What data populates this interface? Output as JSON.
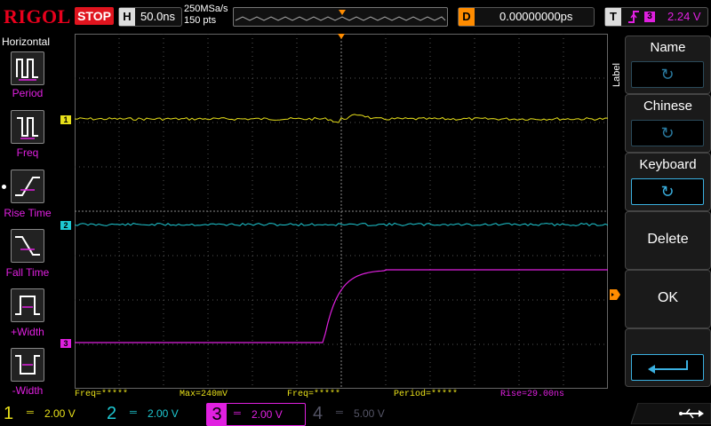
{
  "header": {
    "logo": "RIGOL",
    "run_state": "STOP",
    "horizontal_tag": "H",
    "timebase": "50.0ns",
    "sample_rate": "250MSa/s",
    "points": "150 pts",
    "delay_tag": "D",
    "delay_value": "0.00000000ps",
    "trigger_tag": "T",
    "trigger_source_num": "3",
    "trigger_level": "2.24 V"
  },
  "left_menu": {
    "title": "Horizontal",
    "items": [
      "Period",
      "Freq",
      "Rise Time",
      "Fall Time",
      "+Width",
      "-Width"
    ]
  },
  "right_menu": {
    "section_label": "Label",
    "items": [
      {
        "label": "Name",
        "has_knob": true
      },
      {
        "label": "Chinese",
        "has_knob": true
      },
      {
        "label": "Keyboard",
        "has_knob": true
      },
      {
        "label": "Delete",
        "has_knob": false
      },
      {
        "label": "OK",
        "has_knob": false
      },
      {
        "label": "",
        "has_knob": false,
        "enter": true
      }
    ]
  },
  "channel_markers": [
    "1",
    "2",
    "3"
  ],
  "measurements": {
    "freq1": "Freq=*****",
    "max": "Max=240mV",
    "freq2": "Freq=*****",
    "period": "Period=*****",
    "rise": "Rise=29.00ns"
  },
  "channels": [
    {
      "num": "1",
      "scale": "2.00 V",
      "color": "#e8e01a",
      "active": true
    },
    {
      "num": "2",
      "scale": "2.00 V",
      "color": "#1ec8d2",
      "active": true
    },
    {
      "num": "3",
      "scale": "2.00 V",
      "color": "#e020e0",
      "active": true
    },
    {
      "num": "4",
      "scale": "5.00 V",
      "color": "#2050e0",
      "active": false
    }
  ],
  "colors": {
    "ch1": "#e8e01a",
    "ch2": "#1ec8d2",
    "ch3": "#e020e0",
    "ch4": "#2050e0",
    "trigger": "#ff8c00",
    "accent": "#3ab0e0"
  }
}
